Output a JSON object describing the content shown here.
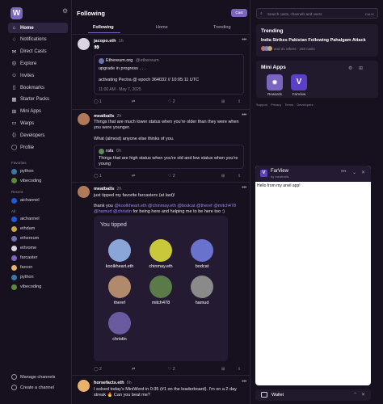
{
  "sidebar": {
    "nav": [
      {
        "label": "Home",
        "icon": "home-icon",
        "glyph": "⌂"
      },
      {
        "label": "Notifications",
        "icon": "bell-icon",
        "glyph": "♢"
      },
      {
        "label": "Direct Casts",
        "icon": "mail-icon",
        "glyph": "✉"
      },
      {
        "label": "Explore",
        "icon": "compass-icon",
        "glyph": "◎"
      },
      {
        "label": "Invites",
        "icon": "user-plus-icon",
        "glyph": "☺"
      },
      {
        "label": "Bookmarks",
        "icon": "bookmark-icon",
        "glyph": "▯"
      },
      {
        "label": "Starter Packs",
        "icon": "starter-pack-icon",
        "glyph": "▦"
      },
      {
        "label": "Mini Apps",
        "icon": "grid-icon",
        "glyph": "⊞"
      },
      {
        "label": "Warps",
        "icon": "warps-icon",
        "glyph": "▭"
      },
      {
        "label": "Developers",
        "icon": "code-icon",
        "glyph": "⟨⟩"
      },
      {
        "label": "Profile",
        "icon": "profile-icon",
        "glyph": "◯"
      }
    ],
    "favorites_label": "Favorites",
    "favorites": [
      {
        "label": "python",
        "color": "#3b77a8"
      },
      {
        "label": "vibecoding",
        "color": "#5a8a3a"
      }
    ],
    "recent_label": "Recent",
    "recent": [
      {
        "label": "aichannel",
        "color": "#1c5bd6"
      }
    ],
    "all_label": "All",
    "all": [
      {
        "label": "aichannel",
        "color": "#1c5bd6"
      },
      {
        "label": "ethdam",
        "color": "#c9a64a"
      },
      {
        "label": "ethereum",
        "color": "#6a72b0"
      },
      {
        "label": "ethrome",
        "color": "#d9d4e0"
      },
      {
        "label": "farcaster",
        "color": "#7c65c1"
      },
      {
        "label": "farcon",
        "color": "#e8b26a"
      },
      {
        "label": "python",
        "color": "#3b77a8"
      },
      {
        "label": "vibecoding",
        "color": "#5a8a3a"
      }
    ],
    "manage_channels": "Manage channels",
    "create_channel": "Create a channel"
  },
  "feed": {
    "title": "Following",
    "cast_button": "Cast",
    "tabs": [
      "Following",
      "Home",
      "Trending"
    ],
    "posts": [
      {
        "author": "jacopo.eth",
        "time": "1h",
        "text": "👀",
        "quote": {
          "author": "Ethereum.org",
          "handle": "@ethereum",
          "lines": [
            "upgrade in progress . . .",
            "activating Pectra @ epoch 364032 // 10:05:11 UTC"
          ],
          "meta": "11:00 AM · May 7, 2025"
        },
        "replies": "1",
        "recasts": "",
        "likes": "2"
      },
      {
        "author": "meatballs",
        "time": "2h",
        "text": "Things that are much lower status when you're older than they were when you were younger.",
        "text2": "What (almost) anyone else thinks of you.",
        "quote": {
          "author": "rafa",
          "time": "6h",
          "lines": [
            "Things that are high status when you're old and low status when you're young"
          ]
        },
        "replies": "1",
        "recasts": "",
        "likes": "2"
      },
      {
        "author": "meatballs",
        "time": "2h",
        "text": "just tipped my favorite farcasters (at last)!",
        "text2_prefix": "thank you ",
        "mentions": "@koolkheart.eth @chinmay.eth @bodcat @theref @mitch478 @hamud @christin",
        "text2_suffix": " for being here and helping me to be here too :)",
        "tipped_title": "You tipped",
        "tipped": [
          {
            "name": "koolkheart.eth",
            "color": "#8aa6d8"
          },
          {
            "name": "chinmay.eth",
            "color": "#c8c83a"
          },
          {
            "name": "bodcat",
            "color": "#6a72d0"
          },
          {
            "name": "theref",
            "color": "#b08a6a"
          },
          {
            "name": "mitch478",
            "color": "#5a7a4a"
          },
          {
            "name": "hamud",
            "color": "#8a8a8a"
          },
          {
            "name": "christin",
            "color": "#6a5aa0"
          }
        ],
        "replies": "2",
        "recasts": "",
        "likes": "2"
      },
      {
        "author": "horsefacts.eth",
        "time": "6h",
        "text": "I solved today's MiniWord in 0:35 (#1 on the leaderboard). I'm on a 2 day streak 🔥 Can you beat me?"
      }
    ]
  },
  "right": {
    "search_placeholder": "Search casts, channels and users",
    "search_shortcut": "Ctrl+K",
    "trending_title": "Trending",
    "trending_headline": "India Strikes Pakistan Following Pahalgam Attack",
    "trending_meta": "and 31 others · 153 casts",
    "mini_apps_title": "Mini Apps",
    "mini_apps": [
      {
        "label": "Rewards",
        "color": "#7c65c1"
      },
      {
        "label": "FarView",
        "color": "#5b3fc4"
      }
    ],
    "footer_links": [
      "Support",
      "Privacy",
      "Terms",
      "Developers"
    ],
    "farview": {
      "title": "FarView",
      "subtitle": "by meatballs",
      "content": "Hello from my anvil app!"
    },
    "wallet_label": "Wallet"
  }
}
